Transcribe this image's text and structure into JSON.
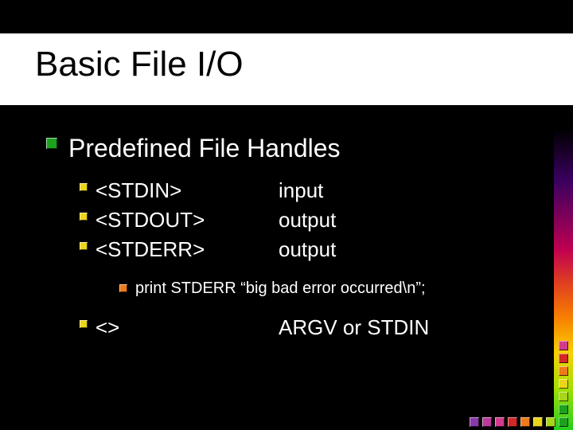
{
  "title": "Basic File I/O",
  "heading": "Predefined File Handles",
  "handles": [
    {
      "name": "<STDIN>",
      "desc": "input"
    },
    {
      "name": "<STDOUT>",
      "desc": "output"
    },
    {
      "name": "<STDERR>",
      "desc": "output"
    }
  ],
  "example": "print STDERR “big bad error occurred\\n”;",
  "diamond": {
    "name": "<>",
    "desc": "ARGV or STDIN"
  },
  "corner_colors_v": [
    "#d23a8e",
    "#d22828",
    "#ee7a1a",
    "#ecd41a",
    "#a8d41a",
    "#1ea021"
  ],
  "corner_colors_h": [
    "#8a3aa8",
    "#b83a9a",
    "#d23a8e",
    "#d22828",
    "#ee7a1a",
    "#ecd41a",
    "#a8d41a",
    "#1ea021"
  ]
}
